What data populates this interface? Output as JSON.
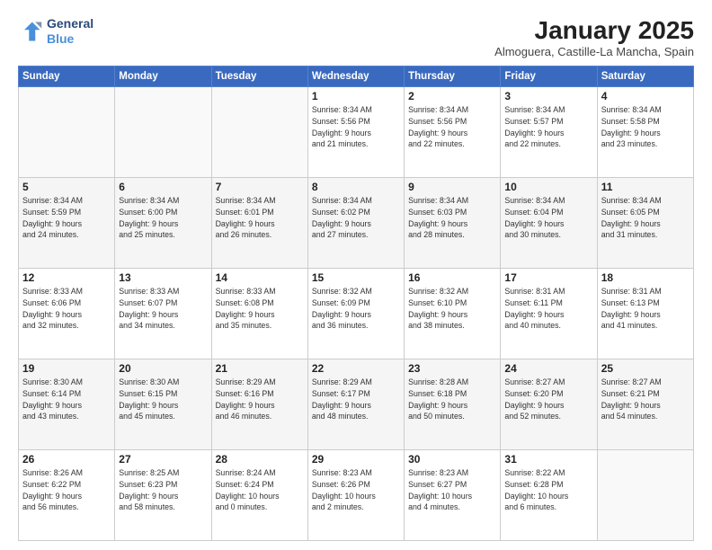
{
  "header": {
    "logo_line1": "General",
    "logo_line2": "Blue",
    "title": "January 2025",
    "location": "Almoguera, Castille-La Mancha, Spain"
  },
  "weekdays": [
    "Sunday",
    "Monday",
    "Tuesday",
    "Wednesday",
    "Thursday",
    "Friday",
    "Saturday"
  ],
  "weeks": [
    [
      {
        "day": "",
        "info": ""
      },
      {
        "day": "",
        "info": ""
      },
      {
        "day": "",
        "info": ""
      },
      {
        "day": "1",
        "info": "Sunrise: 8:34 AM\nSunset: 5:56 PM\nDaylight: 9 hours\nand 21 minutes."
      },
      {
        "day": "2",
        "info": "Sunrise: 8:34 AM\nSunset: 5:56 PM\nDaylight: 9 hours\nand 22 minutes."
      },
      {
        "day": "3",
        "info": "Sunrise: 8:34 AM\nSunset: 5:57 PM\nDaylight: 9 hours\nand 22 minutes."
      },
      {
        "day": "4",
        "info": "Sunrise: 8:34 AM\nSunset: 5:58 PM\nDaylight: 9 hours\nand 23 minutes."
      }
    ],
    [
      {
        "day": "5",
        "info": "Sunrise: 8:34 AM\nSunset: 5:59 PM\nDaylight: 9 hours\nand 24 minutes."
      },
      {
        "day": "6",
        "info": "Sunrise: 8:34 AM\nSunset: 6:00 PM\nDaylight: 9 hours\nand 25 minutes."
      },
      {
        "day": "7",
        "info": "Sunrise: 8:34 AM\nSunset: 6:01 PM\nDaylight: 9 hours\nand 26 minutes."
      },
      {
        "day": "8",
        "info": "Sunrise: 8:34 AM\nSunset: 6:02 PM\nDaylight: 9 hours\nand 27 minutes."
      },
      {
        "day": "9",
        "info": "Sunrise: 8:34 AM\nSunset: 6:03 PM\nDaylight: 9 hours\nand 28 minutes."
      },
      {
        "day": "10",
        "info": "Sunrise: 8:34 AM\nSunset: 6:04 PM\nDaylight: 9 hours\nand 30 minutes."
      },
      {
        "day": "11",
        "info": "Sunrise: 8:34 AM\nSunset: 6:05 PM\nDaylight: 9 hours\nand 31 minutes."
      }
    ],
    [
      {
        "day": "12",
        "info": "Sunrise: 8:33 AM\nSunset: 6:06 PM\nDaylight: 9 hours\nand 32 minutes."
      },
      {
        "day": "13",
        "info": "Sunrise: 8:33 AM\nSunset: 6:07 PM\nDaylight: 9 hours\nand 34 minutes."
      },
      {
        "day": "14",
        "info": "Sunrise: 8:33 AM\nSunset: 6:08 PM\nDaylight: 9 hours\nand 35 minutes."
      },
      {
        "day": "15",
        "info": "Sunrise: 8:32 AM\nSunset: 6:09 PM\nDaylight: 9 hours\nand 36 minutes."
      },
      {
        "day": "16",
        "info": "Sunrise: 8:32 AM\nSunset: 6:10 PM\nDaylight: 9 hours\nand 38 minutes."
      },
      {
        "day": "17",
        "info": "Sunrise: 8:31 AM\nSunset: 6:11 PM\nDaylight: 9 hours\nand 40 minutes."
      },
      {
        "day": "18",
        "info": "Sunrise: 8:31 AM\nSunset: 6:13 PM\nDaylight: 9 hours\nand 41 minutes."
      }
    ],
    [
      {
        "day": "19",
        "info": "Sunrise: 8:30 AM\nSunset: 6:14 PM\nDaylight: 9 hours\nand 43 minutes."
      },
      {
        "day": "20",
        "info": "Sunrise: 8:30 AM\nSunset: 6:15 PM\nDaylight: 9 hours\nand 45 minutes."
      },
      {
        "day": "21",
        "info": "Sunrise: 8:29 AM\nSunset: 6:16 PM\nDaylight: 9 hours\nand 46 minutes."
      },
      {
        "day": "22",
        "info": "Sunrise: 8:29 AM\nSunset: 6:17 PM\nDaylight: 9 hours\nand 48 minutes."
      },
      {
        "day": "23",
        "info": "Sunrise: 8:28 AM\nSunset: 6:18 PM\nDaylight: 9 hours\nand 50 minutes."
      },
      {
        "day": "24",
        "info": "Sunrise: 8:27 AM\nSunset: 6:20 PM\nDaylight: 9 hours\nand 52 minutes."
      },
      {
        "day": "25",
        "info": "Sunrise: 8:27 AM\nSunset: 6:21 PM\nDaylight: 9 hours\nand 54 minutes."
      }
    ],
    [
      {
        "day": "26",
        "info": "Sunrise: 8:26 AM\nSunset: 6:22 PM\nDaylight: 9 hours\nand 56 minutes."
      },
      {
        "day": "27",
        "info": "Sunrise: 8:25 AM\nSunset: 6:23 PM\nDaylight: 9 hours\nand 58 minutes."
      },
      {
        "day": "28",
        "info": "Sunrise: 8:24 AM\nSunset: 6:24 PM\nDaylight: 10 hours\nand 0 minutes."
      },
      {
        "day": "29",
        "info": "Sunrise: 8:23 AM\nSunset: 6:26 PM\nDaylight: 10 hours\nand 2 minutes."
      },
      {
        "day": "30",
        "info": "Sunrise: 8:23 AM\nSunset: 6:27 PM\nDaylight: 10 hours\nand 4 minutes."
      },
      {
        "day": "31",
        "info": "Sunrise: 8:22 AM\nSunset: 6:28 PM\nDaylight: 10 hours\nand 6 minutes."
      },
      {
        "day": "",
        "info": ""
      }
    ]
  ]
}
